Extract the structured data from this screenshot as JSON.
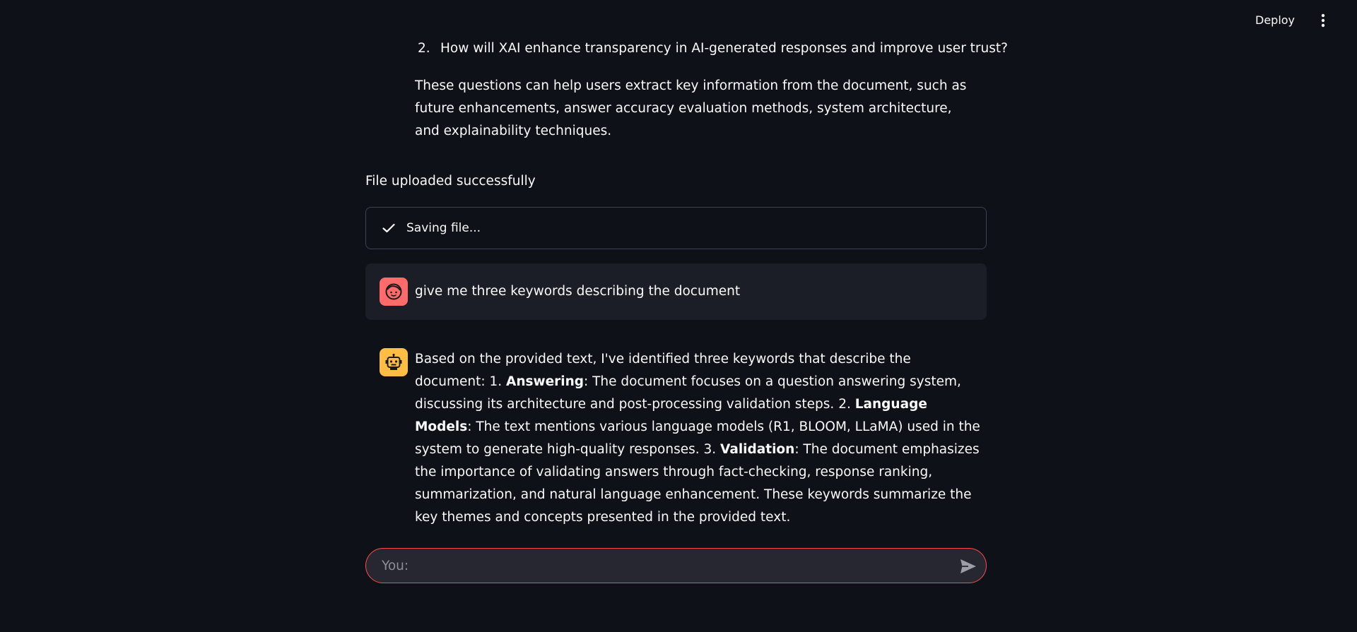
{
  "header": {
    "deploy_label": "Deploy",
    "menu_icon": "vertical-dots-icon"
  },
  "conversation": {
    "numbered_item": {
      "number": "2.",
      "text": "How will XAI enhance transparency in AI-generated responses and improve user trust?"
    },
    "summary_paragraph": "These questions can help users extract key information from the document, such as future enhancements, answer accuracy evaluation methods, system architecture, and explainability techniques.",
    "file_status": "File uploaded successfully",
    "status_box": {
      "icon": "check-icon",
      "label": "Saving file..."
    },
    "user_message": {
      "avatar_icon": "user-face-icon",
      "avatar_color": "#ff6b6b",
      "text": "give me three keywords describing the document"
    },
    "assistant_message": {
      "avatar_icon": "robot-icon",
      "avatar_color": "#ffbd45",
      "intro": "Based on the provided text, I've identified three keywords that describe the document: 1. ",
      "kw1": "Answering",
      "t1": ": The document focuses on a question answering system, discussing its architecture and post-processing validation steps. 2. ",
      "kw2": "Language Models",
      "t2": ": The text mentions various language models (R1, BLOOM, LLaMA) used in the system to generate high-quality responses. 3. ",
      "kw3": "Validation",
      "t3": ": The document emphasizes the importance of validating answers through fact-checking, response ranking, summarization, and natural language enhancement. These keywords summarize the key themes and concepts presented in the provided text."
    }
  },
  "chat_input": {
    "placeholder": "You:",
    "value": "",
    "send_icon": "send-arrow-icon",
    "border_color": "#ff4b4b"
  },
  "colors": {
    "background": "#0e1117",
    "text": "#fafafa",
    "user_bubble": "#1b1e27"
  }
}
